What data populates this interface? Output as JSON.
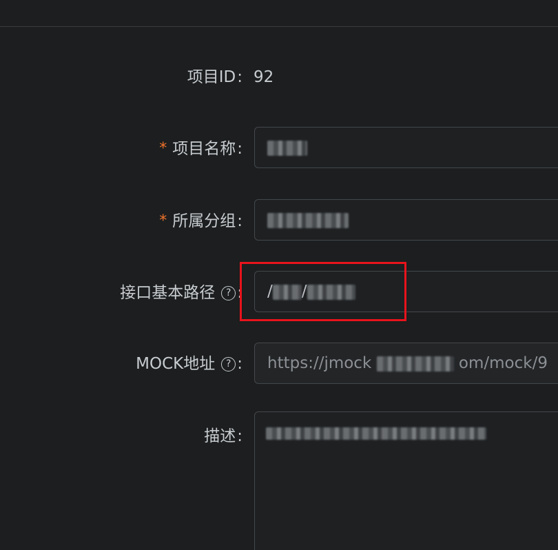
{
  "form": {
    "project_id": {
      "label": "项目ID",
      "colon": ":",
      "value": "92"
    },
    "project_name": {
      "required_mark": "*",
      "label": "项目名称",
      "colon": ":"
    },
    "group": {
      "required_mark": "*",
      "label": "所属分组",
      "colon": ":"
    },
    "base_path": {
      "label": "接口基本路径",
      "help_icon": "?",
      "colon": ":",
      "value_prefix": "/",
      "value_sep": "/"
    },
    "mock_url": {
      "label": "MOCK地址",
      "help_icon": "?",
      "colon": ":",
      "value_start": "https://jmock",
      "value_end": "om/mock/9"
    },
    "description": {
      "label": "描述",
      "colon": ":"
    }
  },
  "colors": {
    "background": "#1c1e1f",
    "required": "#f0732b",
    "highlight_box": "#e8131c"
  }
}
